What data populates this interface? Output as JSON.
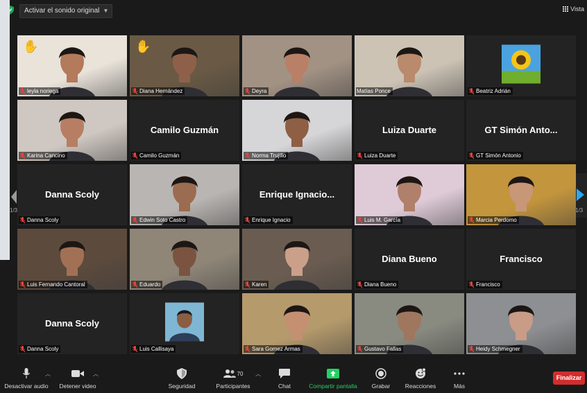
{
  "topbar": {
    "audio_button": "Activar el sonido original",
    "view_label": "Vista"
  },
  "pagination": {
    "left": "1/3",
    "right": "1/3"
  },
  "participants": [
    {
      "name": "leyla noriega",
      "video": true,
      "hand": true,
      "skin": "#b37a5c",
      "bgcolor": "#e9e3da"
    },
    {
      "name": "Diana Hernández",
      "video": true,
      "hand": true,
      "active": true,
      "skin": "#8f6049",
      "bgcolor": "#6a5a45"
    },
    {
      "name": "Deyra",
      "video": true,
      "skin": "#b98068",
      "bgcolor": "#a29284"
    },
    {
      "name": "Matías Ponce",
      "video": true,
      "unmuted": true,
      "skin": "#b98a6c",
      "bgcolor": "#ccc3b5"
    },
    {
      "name": "Beatriz Adrián",
      "video": false,
      "avatar": "sunflower"
    },
    {
      "name": "Karina Cancino",
      "video": true,
      "skin": "#b77e63",
      "bgcolor": "#cfc7c1"
    },
    {
      "name": "Camilo Guzmán",
      "video": false
    },
    {
      "name": "Norma Trujillo",
      "video": true,
      "skin": "#8e5f45",
      "bgcolor": "#d6d6d8"
    },
    {
      "name": "Luiza Duarte",
      "video": false
    },
    {
      "name": "GT Simón Antonio",
      "video": false
    },
    {
      "name": "Danna Scoly",
      "video": false
    },
    {
      "name": "Edwin Soto Castro",
      "video": true,
      "skin": "#9b6c50",
      "bgcolor": "#b9b5b2"
    },
    {
      "name": "Enrique Ignacio",
      "video": false
    },
    {
      "name": "Luis M. García",
      "video": true,
      "skin": "#b0806a",
      "bgcolor": "#dfcbd8"
    },
    {
      "name": "Marcia Perdomo",
      "video": true,
      "skin": "#c89777",
      "bgcolor": "#c3953d"
    },
    {
      "name": "Luis Fernando Cantoral",
      "video": true,
      "skin": "#a27155",
      "bgcolor": "#5c4a3d"
    },
    {
      "name": "Eduardo",
      "video": true,
      "skin": "#7a5440",
      "bgcolor": "#8f8678"
    },
    {
      "name": "Karen",
      "video": true,
      "skin": "#caa08a",
      "bgcolor": "#6a5c50"
    },
    {
      "name": "Diana Bueno",
      "video": false
    },
    {
      "name": "Francisco",
      "video": false
    },
    {
      "name": "Danna Scoly",
      "video": false
    },
    {
      "name": "Luis Callisaya",
      "video": false,
      "avatar": "portrait"
    },
    {
      "name": "Sara Gomez Armas",
      "video": true,
      "skin": "#c58f72",
      "bgcolor": "#b59a6c"
    },
    {
      "name": "Gustavo Fallas",
      "video": true,
      "skin": "#9f765e",
      "bgcolor": "#898a80"
    },
    {
      "name": "Heidy Schmegner",
      "video": true,
      "skin": "#c89c86",
      "bgcolor": "#8d8f92"
    }
  ],
  "display": {
    "camilo": "Camilo Guzmán",
    "luiza": "Luiza Duarte",
    "gt": "GT Simón Anto...",
    "danna1": "Danna Scoly",
    "enrique": "Enrique Ignacio...",
    "diana_bueno": "Diana Bueno",
    "francisco": "Francisco",
    "danna2": "Danna Scoly"
  },
  "toolbar": {
    "mute": "Desactivar audio",
    "video": "Detener video",
    "security": "Seguridad",
    "participants": "Participantes",
    "participant_count": "70",
    "chat": "Chat",
    "share": "Compartir pantalla",
    "record": "Grabar",
    "reactions": "Reacciones",
    "more": "Más",
    "end": "Finalizar"
  },
  "colors": {
    "accent_green": "#23d160",
    "end_red": "#d22d2d",
    "speaker_outline": "#c9e04a",
    "arrow_blue": "#2aa7f0"
  }
}
